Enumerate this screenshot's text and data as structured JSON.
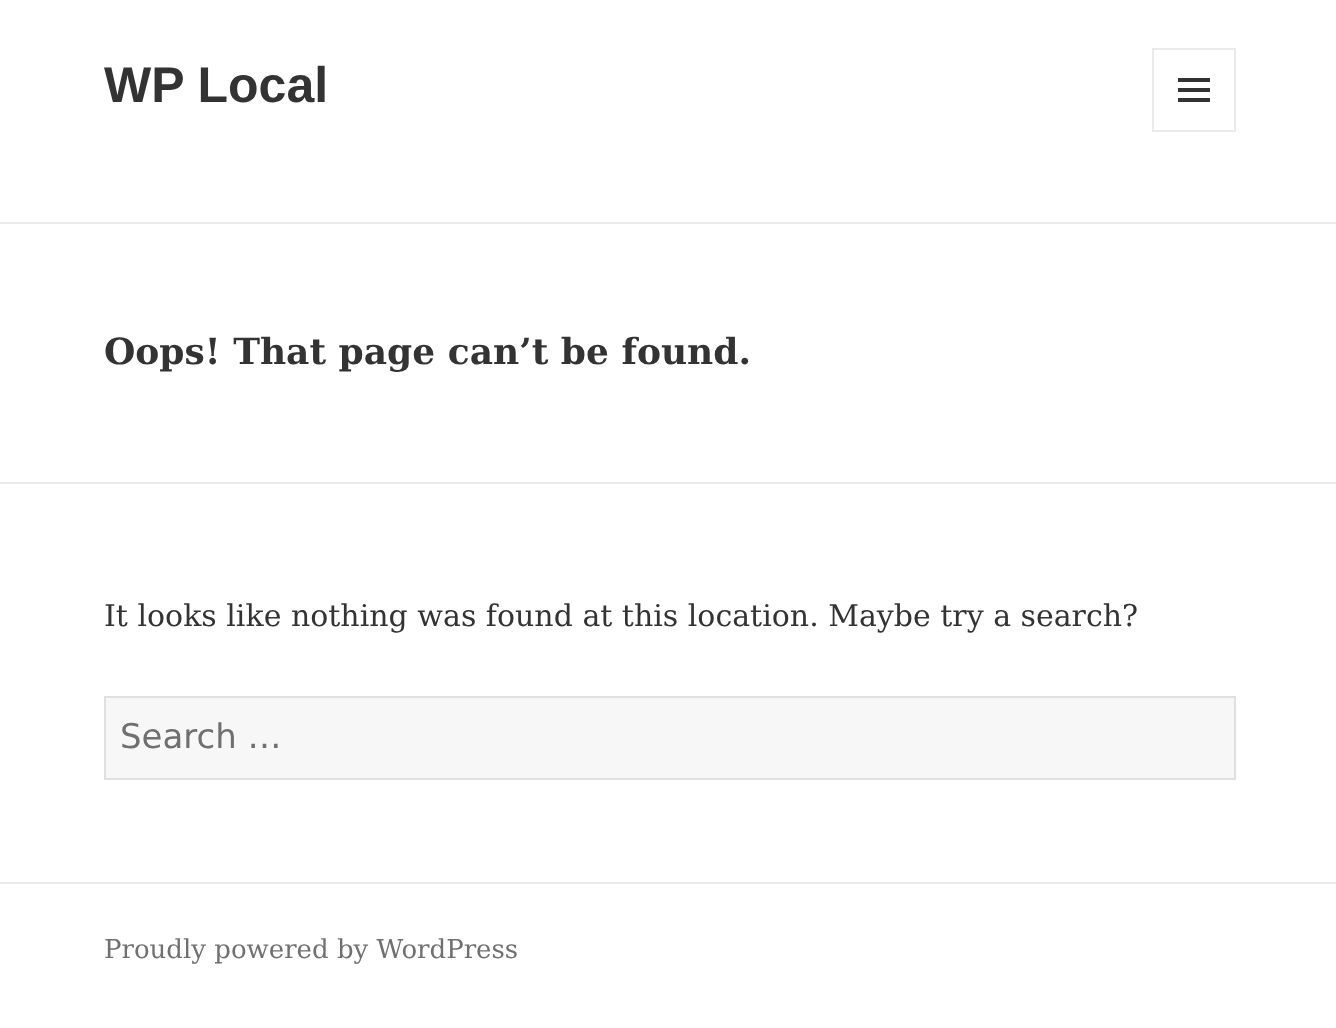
{
  "site_title": "WP Local",
  "page_title": "Oops! That page can’t be found.",
  "message": "It looks like nothing was found at this location. Maybe try a search?",
  "search": {
    "placeholder": "Search …"
  },
  "footer": {
    "credit": "Proudly powered by WordPress"
  }
}
